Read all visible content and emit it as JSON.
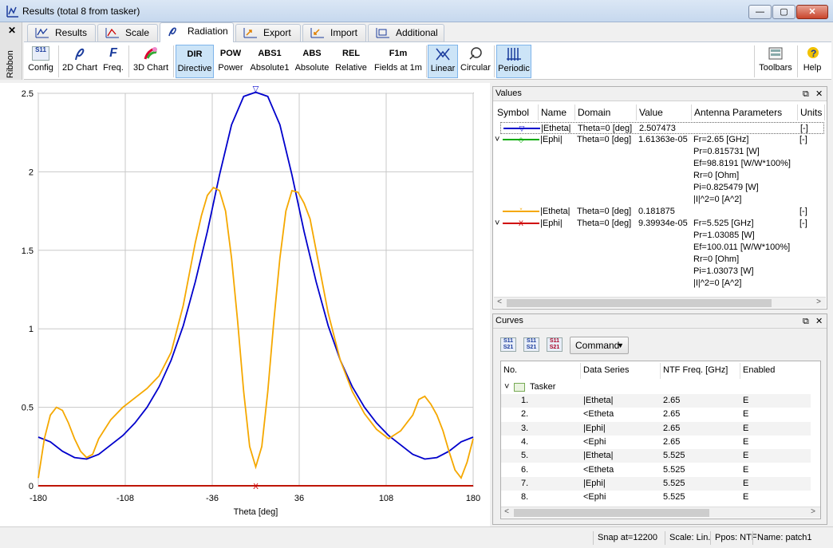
{
  "window": {
    "title": "Results (total 8 from tasker)",
    "min": "—",
    "max": "▢",
    "close": "✕"
  },
  "ribbon_side": {
    "close": "✕",
    "label": "Ribbon"
  },
  "tabs": [
    {
      "label": "Results",
      "icon": "chart-icon"
    },
    {
      "label": "Scale",
      "icon": "scale-icon"
    },
    {
      "label": "Radiation",
      "icon": "radiation-icon"
    },
    {
      "label": "Export",
      "icon": "export-icon"
    },
    {
      "label": "Import",
      "icon": "import-icon"
    },
    {
      "label": "Additional",
      "icon": "additional-icon"
    }
  ],
  "toolbar": {
    "config": {
      "label": "Config",
      "glyph": "S11"
    },
    "chart2d": {
      "label": "2D Chart"
    },
    "freq": {
      "label": "Freq.",
      "glyph": "F"
    },
    "chart3d": {
      "label": "3D Chart"
    },
    "directive": {
      "label": "Directive",
      "glyph": "DIR"
    },
    "power": {
      "label": "Power",
      "glyph": "POW"
    },
    "absolute1": {
      "label": "Absolute1",
      "glyph": "ABS1"
    },
    "absolute": {
      "label": "Absolute",
      "glyph": "ABS"
    },
    "relative": {
      "label": "Relative",
      "glyph": "REL"
    },
    "fields1m": {
      "label": "Fields at 1m",
      "glyph": "F1m"
    },
    "linear": {
      "label": "Linear"
    },
    "circular": {
      "label": "Circular"
    },
    "periodic": {
      "label": "Periodic"
    },
    "toolbars": {
      "label": "Toolbars"
    },
    "help": {
      "label": "Help"
    }
  },
  "chart_data": {
    "type": "line",
    "xlabel": "Theta [deg]",
    "ylabel": "",
    "xlim": [
      -180,
      180
    ],
    "ylim": [
      0,
      2.5
    ],
    "xticks": [
      "-180",
      "-108",
      "-36",
      "36",
      "108",
      "180"
    ],
    "yticks": [
      "0",
      "0.5",
      "1",
      "1.5",
      "2",
      "2.5"
    ],
    "grid": true,
    "series": [
      {
        "color": "#0000cc",
        "x": [
          -180,
          -170,
          -160,
          -150,
          -140,
          -130,
          -120,
          -110,
          -100,
          -90,
          -80,
          -70,
          -60,
          -50,
          -40,
          -30,
          -20,
          -10,
          0,
          10,
          20,
          30,
          40,
          50,
          60,
          70,
          80,
          90,
          100,
          110,
          120,
          130,
          140,
          150,
          160,
          170,
          180
        ],
        "y": [
          0.31,
          0.28,
          0.22,
          0.18,
          0.17,
          0.2,
          0.26,
          0.32,
          0.4,
          0.5,
          0.63,
          0.8,
          1.02,
          1.3,
          1.62,
          1.98,
          2.3,
          2.48,
          2.507,
          2.48,
          2.3,
          1.98,
          1.62,
          1.3,
          1.02,
          0.8,
          0.63,
          0.5,
          0.4,
          0.32,
          0.26,
          0.2,
          0.17,
          0.18,
          0.22,
          0.28,
          0.31
        ]
      },
      {
        "color": "#f5a800",
        "x": [
          -180,
          -175,
          -170,
          -165,
          -160,
          -155,
          -150,
          -145,
          -140,
          -135,
          -130,
          -120,
          -110,
          -100,
          -90,
          -80,
          -70,
          -60,
          -50,
          -45,
          -40,
          -35,
          -30,
          -25,
          -20,
          -15,
          -10,
          -5,
          0,
          5,
          10,
          15,
          20,
          25,
          30,
          35,
          40,
          45,
          50,
          60,
          70,
          80,
          90,
          100,
          110,
          120,
          130,
          135,
          140,
          145,
          150,
          155,
          160,
          165,
          170,
          175,
          180
        ],
        "y": [
          0.05,
          0.3,
          0.45,
          0.5,
          0.48,
          0.4,
          0.3,
          0.22,
          0.18,
          0.2,
          0.3,
          0.42,
          0.5,
          0.56,
          0.62,
          0.7,
          0.85,
          1.15,
          1.55,
          1.72,
          1.85,
          1.9,
          1.88,
          1.75,
          1.45,
          1.05,
          0.6,
          0.25,
          0.12,
          0.25,
          0.6,
          1.05,
          1.45,
          1.75,
          1.88,
          1.87,
          1.8,
          1.7,
          1.5,
          1.1,
          0.8,
          0.6,
          0.46,
          0.36,
          0.3,
          0.35,
          0.45,
          0.55,
          0.57,
          0.52,
          0.45,
          0.35,
          0.22,
          0.1,
          0.05,
          0.15,
          0.3
        ]
      },
      {
        "color": "#008800",
        "x": [
          -180,
          180
        ],
        "y": [
          0.00016,
          0.00016
        ]
      },
      {
        "color": "#d00000",
        "x": [
          -180,
          180
        ],
        "y": [
          9e-05,
          9e-05
        ]
      }
    ],
    "markers": [
      {
        "x": 0,
        "y": 2.507,
        "symbol": "▽",
        "color": "#0000cc"
      },
      {
        "x": 0,
        "y": 0.0,
        "symbol": "X",
        "color": "#d00000"
      }
    ]
  },
  "values_pane": {
    "title": "Values",
    "headers": [
      "Symbol",
      "Name",
      "Domain",
      "Value",
      "Antenna Parameters",
      "Units"
    ],
    "rows": [
      {
        "name": "|Etheta|",
        "domain": "Theta=0 [deg]",
        "value": "2.507473",
        "params": [],
        "units": "[-]",
        "color": "#0000cc",
        "mark": "▽"
      },
      {
        "name": "|Ephi|",
        "domain": "Theta=0 [deg]",
        "value": "1.61363e-05",
        "params": [
          "Fr=2.65 [GHz]",
          "Pr=0.815731 [W]",
          "Ef=98.8191 [W/W*100%]",
          "Rr=0 [Ohm]",
          "Pi=0.825479 [W]",
          "|I|^2=0 [A^2]"
        ],
        "units": "[-]",
        "color": "#00aa00",
        "mark": "◇"
      },
      {
        "name": "|Etheta|",
        "domain": "Theta=0 [deg]",
        "value": "0.181875",
        "params": [],
        "units": "[-]",
        "color": "#f5a800",
        "mark": "˅"
      },
      {
        "name": "|Ephi|",
        "domain": "Theta=0 [deg]",
        "value": "9.39934e-05",
        "params": [
          "Fr=5.525 [GHz]",
          "Pr=1.03085 [W]",
          "Ef=100.011 [W/W*100%]",
          "Rr=0 [Ohm]",
          "Pi=1.03073 [W]",
          "|I|^2=0 [A^2]"
        ],
        "units": "[-]",
        "color": "#d00000",
        "mark": "X"
      }
    ]
  },
  "curves_pane": {
    "title": "Curves",
    "command": "Command",
    "headers": [
      "No.",
      "Data Series",
      "NTF Freq. [GHz]",
      "Enabled"
    ],
    "group": "Tasker",
    "rows": [
      {
        "no": "1.",
        "series": "|Etheta|",
        "freq": "2.65",
        "enabled": "E"
      },
      {
        "no": "2.",
        "series": "<Etheta",
        "freq": "2.65",
        "enabled": "E"
      },
      {
        "no": "3.",
        "series": "|Ephi|",
        "freq": "2.65",
        "enabled": "E"
      },
      {
        "no": "4.",
        "series": "<Ephi",
        "freq": "2.65",
        "enabled": "E"
      },
      {
        "no": "5.",
        "series": "|Etheta|",
        "freq": "5.525",
        "enabled": "E"
      },
      {
        "no": "6.",
        "series": "<Etheta",
        "freq": "5.525",
        "enabled": "E"
      },
      {
        "no": "7.",
        "series": "|Ephi|",
        "freq": "5.525",
        "enabled": "E"
      },
      {
        "no": "8.",
        "series": "<Ephi",
        "freq": "5.525",
        "enabled": "E"
      }
    ]
  },
  "status": {
    "snap": "Snap at=12200",
    "scale": "Scale: Lin.",
    "ppos": "Ppos: NTF",
    "name": "Name: patch1"
  }
}
